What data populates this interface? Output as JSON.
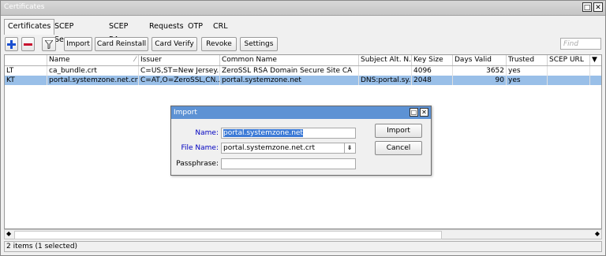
{
  "window": {
    "title": "Certificates"
  },
  "tabs": [
    "Certificates",
    "SCEP Servers",
    "SCEP RA",
    "Requests",
    "OTP",
    "CRL"
  ],
  "toolbar": {
    "import_label": "Import",
    "card_reinstall_label": "Card Reinstall",
    "card_verify_label": "Card Verify",
    "revoke_label": "Revoke",
    "settings_label": "Settings",
    "find_placeholder": "Find"
  },
  "table": {
    "columns": [
      "",
      "Name",
      "Issuer",
      "Common Name",
      "Subject Alt. N...",
      "Key Size",
      "Days Valid",
      "Trusted",
      "SCEP URL"
    ],
    "rows": [
      {
        "flags": "LT",
        "name": "ca_bundle.crt",
        "issuer": "C=US,ST=New Jersey...",
        "common_name": "ZeroSSL RSA Domain Secure Site CA",
        "san": "",
        "key_size": "4096",
        "days_valid": "3652",
        "trusted": "yes",
        "scep_url": "",
        "selected": false
      },
      {
        "flags": "KT",
        "name": "portal.systemzone.net.crt",
        "issuer": "C=AT,O=ZeroSSL,CN...",
        "common_name": "portal.systemzone.net",
        "san": "DNS:portal.sy...",
        "key_size": "2048",
        "days_valid": "90",
        "trusted": "yes",
        "scep_url": "",
        "selected": true
      }
    ]
  },
  "status": {
    "text": "2 items (1 selected)"
  },
  "dialog": {
    "title": "Import",
    "name_label": "Name:",
    "name_value": "portal.systemzone.net",
    "file_label": "File Name:",
    "file_value": "portal.systemzone.net.crt",
    "pass_label": "Passphrase:",
    "pass_value": "",
    "import_button": "Import",
    "cancel_button": "Cancel"
  },
  "colors": {
    "selection": "#99bfe8",
    "dialog_title": "#5d92d4",
    "add": "#1a4fd0",
    "remove": "#c8102e"
  }
}
